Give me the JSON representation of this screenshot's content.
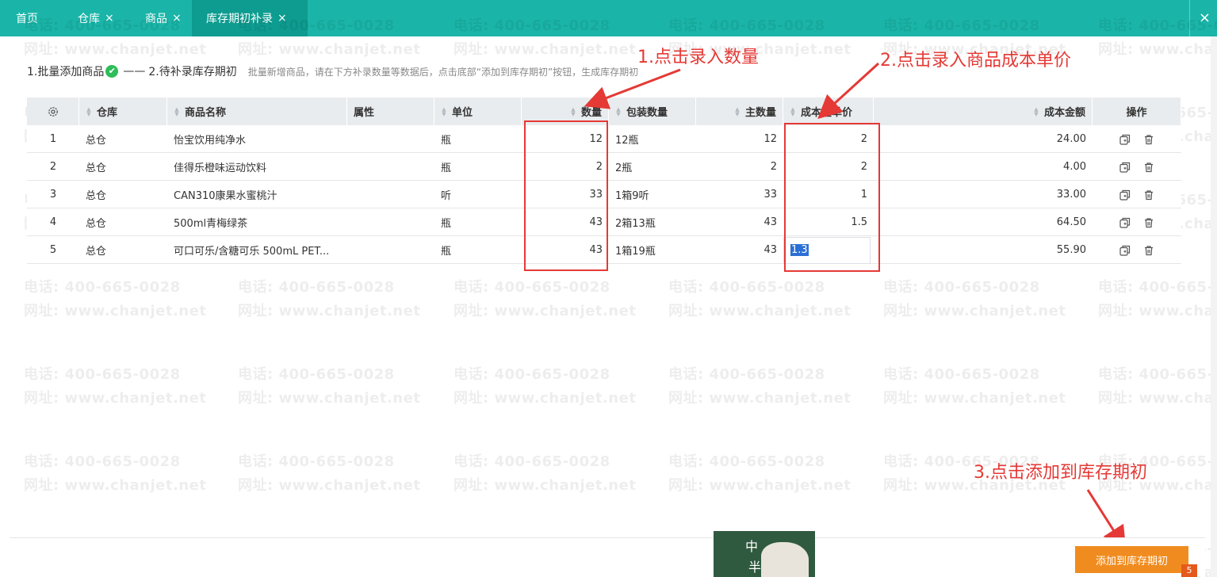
{
  "tabs": [
    {
      "label": "首页",
      "closable": false,
      "active": false
    },
    {
      "label": "仓库",
      "closable": true,
      "active": false
    },
    {
      "label": "商品",
      "closable": true,
      "active": false
    },
    {
      "label": "库存期初补录",
      "closable": true,
      "active": true
    }
  ],
  "close_symbol": "×",
  "watermark": {
    "phone": "电话: 400-665-0028",
    "site": "网址: www.chanjet.net"
  },
  "steps": {
    "step1": "1.批量添加商品",
    "check": "✔",
    "dash": "——",
    "step2": "2.待补录库存期初",
    "hint": "批量新增商品，请在下方补录数量等数据后，点击底部“添加到库存期初”按钮，生成库存期初"
  },
  "table": {
    "headers": [
      "",
      "仓库",
      "商品名称",
      "属性",
      "单位",
      "数量",
      "包装数量",
      "主数量",
      "成本主单价",
      "成本金额",
      "操作"
    ],
    "rows": [
      {
        "no": "1",
        "warehouse": "总仓",
        "name": "怡宝饮用纯净水",
        "attr": "",
        "unit": "瓶",
        "qty": "12",
        "pack": "12瓶",
        "main_qty": "12",
        "price": "2",
        "amount": "24.00"
      },
      {
        "no": "2",
        "warehouse": "总仓",
        "name": "佳得乐橙味运动饮料",
        "attr": "",
        "unit": "瓶",
        "qty": "2",
        "pack": "2瓶",
        "main_qty": "2",
        "price": "2",
        "amount": "4.00"
      },
      {
        "no": "3",
        "warehouse": "总仓",
        "name": "CAN310康果水蜜桃汁",
        "attr": "",
        "unit": "听",
        "qty": "33",
        "pack": "1箱9听",
        "main_qty": "33",
        "price": "1",
        "amount": "33.00"
      },
      {
        "no": "4",
        "warehouse": "总仓",
        "name": "500ml青梅绿茶",
        "attr": "",
        "unit": "瓶",
        "qty": "43",
        "pack": "2箱13瓶",
        "main_qty": "43",
        "price": "1.5",
        "amount": "64.50"
      },
      {
        "no": "5",
        "warehouse": "总仓",
        "name": "可口可乐/含糖可乐 500mL PET...",
        "attr": "",
        "unit": "瓶",
        "qty": "43",
        "pack": "1箱19瓶",
        "main_qty": "43",
        "price": "1.3",
        "amount": "55.90"
      }
    ]
  },
  "annotations": {
    "a1": "1.点击录入数量",
    "a2": "2.点击录入商品成本单价",
    "a3": "3.点击添加到库存期初",
    "color": "#e53935"
  },
  "mascot": {
    "t1": "中",
    "t2": "半"
  },
  "submit_button": "添加到库存期初",
  "corner_badge": "5",
  "colors": {
    "tabbar": "#1ab5a8",
    "accent_button": "#f08c1f",
    "highlight": "#e53935"
  }
}
